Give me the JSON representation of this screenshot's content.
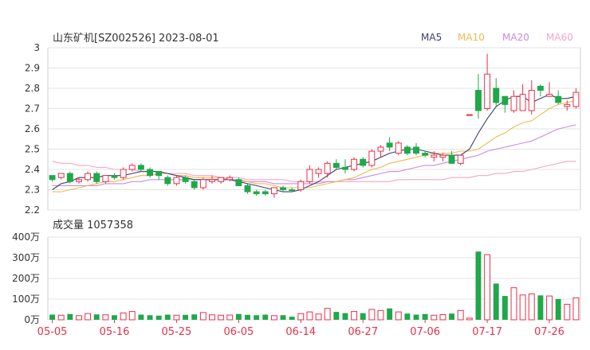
{
  "title": "山东矿机[SZ002526] 2023-08-01",
  "legend": [
    {
      "name": "MA5",
      "color": "#3a3f6b"
    },
    {
      "name": "MA10",
      "color": "#f2b84b"
    },
    {
      "name": "MA20",
      "color": "#c98be0"
    },
    {
      "name": "MA60",
      "color": "#f4a6c8"
    }
  ],
  "colors": {
    "up": "#e8314b",
    "down": "#1fa84a"
  },
  "volume_label": "成交量 1057358",
  "chart_data": {
    "type": "candlestick",
    "price_axis": {
      "min": 2.2,
      "max": 3.0,
      "ticks": [
        "2.2",
        "2.3",
        "2.4",
        "2.5",
        "2.6",
        "2.7",
        "2.8",
        "2.9",
        "3"
      ]
    },
    "volume_axis": {
      "min": 0,
      "max": 4000000,
      "ticks": [
        "0万",
        "100万",
        "200万",
        "300万",
        "400万"
      ]
    },
    "x_ticks": [
      {
        "index": 0,
        "label": "05-05"
      },
      {
        "index": 7,
        "label": "05-16"
      },
      {
        "index": 14,
        "label": "05-25"
      },
      {
        "index": 21,
        "label": "06-05"
      },
      {
        "index": 28,
        "label": "06-14"
      },
      {
        "index": 35,
        "label": "06-27"
      },
      {
        "index": 42,
        "label": "07-06"
      },
      {
        "index": 49,
        "label": "07-17"
      },
      {
        "index": 56,
        "label": "07-26"
      }
    ],
    "candles": [
      [
        2.35,
        2.37,
        2.34,
        2.37,
        25,
        "down"
      ],
      [
        2.36,
        2.38,
        2.35,
        2.38,
        22,
        "up"
      ],
      [
        2.38,
        2.39,
        2.33,
        2.34,
        28,
        "down"
      ],
      [
        2.34,
        2.36,
        2.33,
        2.35,
        20,
        "up"
      ],
      [
        2.35,
        2.39,
        2.34,
        2.38,
        30,
        "up"
      ],
      [
        2.38,
        2.39,
        2.33,
        2.34,
        26,
        "down"
      ],
      [
        2.34,
        2.37,
        2.33,
        2.37,
        24,
        "up"
      ],
      [
        2.37,
        2.38,
        2.35,
        2.36,
        22,
        "down"
      ],
      [
        2.36,
        2.41,
        2.35,
        2.4,
        33,
        "up"
      ],
      [
        2.4,
        2.43,
        2.39,
        2.42,
        40,
        "up"
      ],
      [
        2.42,
        2.43,
        2.39,
        2.4,
        25,
        "down"
      ],
      [
        2.4,
        2.41,
        2.36,
        2.37,
        22,
        "down"
      ],
      [
        2.37,
        2.39,
        2.35,
        2.39,
        20,
        "down"
      ],
      [
        2.36,
        2.37,
        2.32,
        2.33,
        25,
        "down"
      ],
      [
        2.33,
        2.37,
        2.32,
        2.36,
        22,
        "up"
      ],
      [
        2.36,
        2.37,
        2.33,
        2.34,
        24,
        "down"
      ],
      [
        2.34,
        2.35,
        2.3,
        2.31,
        26,
        "down"
      ],
      [
        2.31,
        2.36,
        2.3,
        2.35,
        35,
        "up"
      ],
      [
        2.35,
        2.37,
        2.33,
        2.34,
        24,
        "up"
      ],
      [
        2.34,
        2.36,
        2.33,
        2.36,
        22,
        "up"
      ],
      [
        2.36,
        2.37,
        2.34,
        2.35,
        23,
        "up"
      ],
      [
        2.35,
        2.36,
        2.32,
        2.32,
        28,
        "down"
      ],
      [
        2.32,
        2.33,
        2.28,
        2.29,
        24,
        "down"
      ],
      [
        2.29,
        2.3,
        2.27,
        2.28,
        22,
        "down"
      ],
      [
        2.28,
        2.3,
        2.27,
        2.29,
        25,
        "down"
      ],
      [
        2.28,
        2.31,
        2.26,
        2.31,
        20,
        "up"
      ],
      [
        2.31,
        2.32,
        2.29,
        2.3,
        22,
        "down"
      ],
      [
        2.3,
        2.31,
        2.29,
        2.3,
        15,
        "down"
      ],
      [
        2.3,
        2.35,
        2.29,
        2.34,
        30,
        "up"
      ],
      [
        2.34,
        2.42,
        2.33,
        2.4,
        38,
        "up"
      ],
      [
        2.4,
        2.41,
        2.36,
        2.38,
        28,
        "up"
      ],
      [
        2.38,
        2.44,
        2.36,
        2.43,
        55,
        "up"
      ],
      [
        2.43,
        2.45,
        2.4,
        2.41,
        38,
        "down"
      ],
      [
        2.41,
        2.45,
        2.38,
        2.4,
        32,
        "down"
      ],
      [
        2.4,
        2.46,
        2.39,
        2.45,
        40,
        "up"
      ],
      [
        2.45,
        2.46,
        2.41,
        2.42,
        32,
        "down"
      ],
      [
        2.42,
        2.5,
        2.41,
        2.49,
        50,
        "up"
      ],
      [
        2.49,
        2.52,
        2.46,
        2.51,
        45,
        "up"
      ],
      [
        2.51,
        2.56,
        2.49,
        2.53,
        55,
        "down"
      ],
      [
        2.53,
        2.54,
        2.47,
        2.48,
        38,
        "up"
      ],
      [
        2.48,
        2.52,
        2.47,
        2.51,
        30,
        "down"
      ],
      [
        2.51,
        2.53,
        2.47,
        2.48,
        25,
        "down"
      ],
      [
        2.48,
        2.49,
        2.46,
        2.47,
        28,
        "down"
      ],
      [
        2.47,
        2.49,
        2.44,
        2.46,
        22,
        "up"
      ],
      [
        2.46,
        2.48,
        2.44,
        2.47,
        25,
        "up"
      ],
      [
        2.47,
        2.49,
        2.43,
        2.43,
        30,
        "down"
      ],
      [
        2.43,
        2.47,
        2.42,
        2.47,
        45,
        "up"
      ],
      [
        2.67,
        2.67,
        2.67,
        2.67,
        8,
        "up"
      ],
      [
        2.69,
        2.87,
        2.65,
        2.79,
        330,
        "down"
      ],
      [
        2.7,
        2.97,
        2.69,
        2.87,
        315,
        "up"
      ],
      [
        2.8,
        2.85,
        2.71,
        2.73,
        175,
        "down"
      ],
      [
        2.72,
        2.76,
        2.68,
        2.76,
        115,
        "down"
      ],
      [
        2.69,
        2.79,
        2.68,
        2.76,
        155,
        "up"
      ],
      [
        2.77,
        2.82,
        2.7,
        2.69,
        120,
        "up"
      ],
      [
        2.69,
        2.84,
        2.67,
        2.79,
        125,
        "up"
      ],
      [
        2.79,
        2.82,
        2.76,
        2.81,
        118,
        "down"
      ],
      [
        2.77,
        2.83,
        2.76,
        2.76,
        115,
        "up"
      ],
      [
        2.76,
        2.79,
        2.72,
        2.73,
        100,
        "down"
      ],
      [
        2.72,
        2.74,
        2.69,
        2.71,
        75,
        "up"
      ],
      [
        2.71,
        2.8,
        2.7,
        2.78,
        106,
        "up"
      ]
    ],
    "ma5": [
      2.3,
      2.33,
      2.34,
      2.36,
      2.36,
      2.36,
      2.37,
      2.37,
      2.37,
      2.38,
      2.39,
      2.39,
      2.39,
      2.38,
      2.37,
      2.36,
      2.35,
      2.35,
      2.35,
      2.35,
      2.35,
      2.34,
      2.33,
      2.32,
      2.31,
      2.3,
      2.29,
      2.29,
      2.3,
      2.32,
      2.34,
      2.37,
      2.4,
      2.41,
      2.42,
      2.43,
      2.44,
      2.46,
      2.48,
      2.49,
      2.5,
      2.5,
      2.49,
      2.48,
      2.47,
      2.47,
      2.47,
      2.5,
      2.58,
      2.65,
      2.71,
      2.74,
      2.76,
      2.76,
      2.73,
      2.75,
      2.77,
      2.75,
      2.75,
      2.76
    ],
    "ma10": [
      2.29,
      2.29,
      2.3,
      2.31,
      2.32,
      2.33,
      2.34,
      2.34,
      2.35,
      2.36,
      2.37,
      2.37,
      2.38,
      2.38,
      2.37,
      2.37,
      2.36,
      2.36,
      2.36,
      2.36,
      2.35,
      2.34,
      2.34,
      2.33,
      2.33,
      2.32,
      2.31,
      2.31,
      2.31,
      2.31,
      2.32,
      2.33,
      2.34,
      2.35,
      2.36,
      2.38,
      2.4,
      2.41,
      2.43,
      2.44,
      2.45,
      2.46,
      2.47,
      2.48,
      2.48,
      2.48,
      2.49,
      2.49,
      2.5,
      2.53,
      2.56,
      2.58,
      2.61,
      2.63,
      2.64,
      2.67,
      2.7,
      2.72,
      2.73,
      2.74
    ],
    "ma20": [
      2.32,
      2.32,
      2.32,
      2.32,
      2.32,
      2.32,
      2.33,
      2.33,
      2.33,
      2.34,
      2.34,
      2.35,
      2.35,
      2.35,
      2.35,
      2.35,
      2.35,
      2.35,
      2.35,
      2.35,
      2.35,
      2.35,
      2.34,
      2.34,
      2.34,
      2.33,
      2.33,
      2.33,
      2.33,
      2.33,
      2.33,
      2.34,
      2.34,
      2.35,
      2.35,
      2.36,
      2.37,
      2.38,
      2.39,
      2.39,
      2.4,
      2.41,
      2.42,
      2.42,
      2.43,
      2.44,
      2.45,
      2.46,
      2.47,
      2.49,
      2.5,
      2.51,
      2.52,
      2.53,
      2.54,
      2.56,
      2.58,
      2.6,
      2.61,
      2.62
    ],
    "ma60": [
      2.44,
      2.43,
      2.43,
      2.42,
      2.42,
      2.41,
      2.41,
      2.4,
      2.4,
      2.4,
      2.39,
      2.39,
      2.39,
      2.38,
      2.38,
      2.38,
      2.37,
      2.37,
      2.37,
      2.36,
      2.36,
      2.36,
      2.35,
      2.35,
      2.35,
      2.35,
      2.35,
      2.34,
      2.34,
      2.34,
      2.34,
      2.34,
      2.34,
      2.34,
      2.34,
      2.34,
      2.34,
      2.34,
      2.34,
      2.35,
      2.35,
      2.35,
      2.35,
      2.35,
      2.35,
      2.36,
      2.36,
      2.36,
      2.37,
      2.37,
      2.38,
      2.38,
      2.39,
      2.39,
      2.4,
      2.41,
      2.42,
      2.43,
      2.44,
      2.44
    ]
  }
}
